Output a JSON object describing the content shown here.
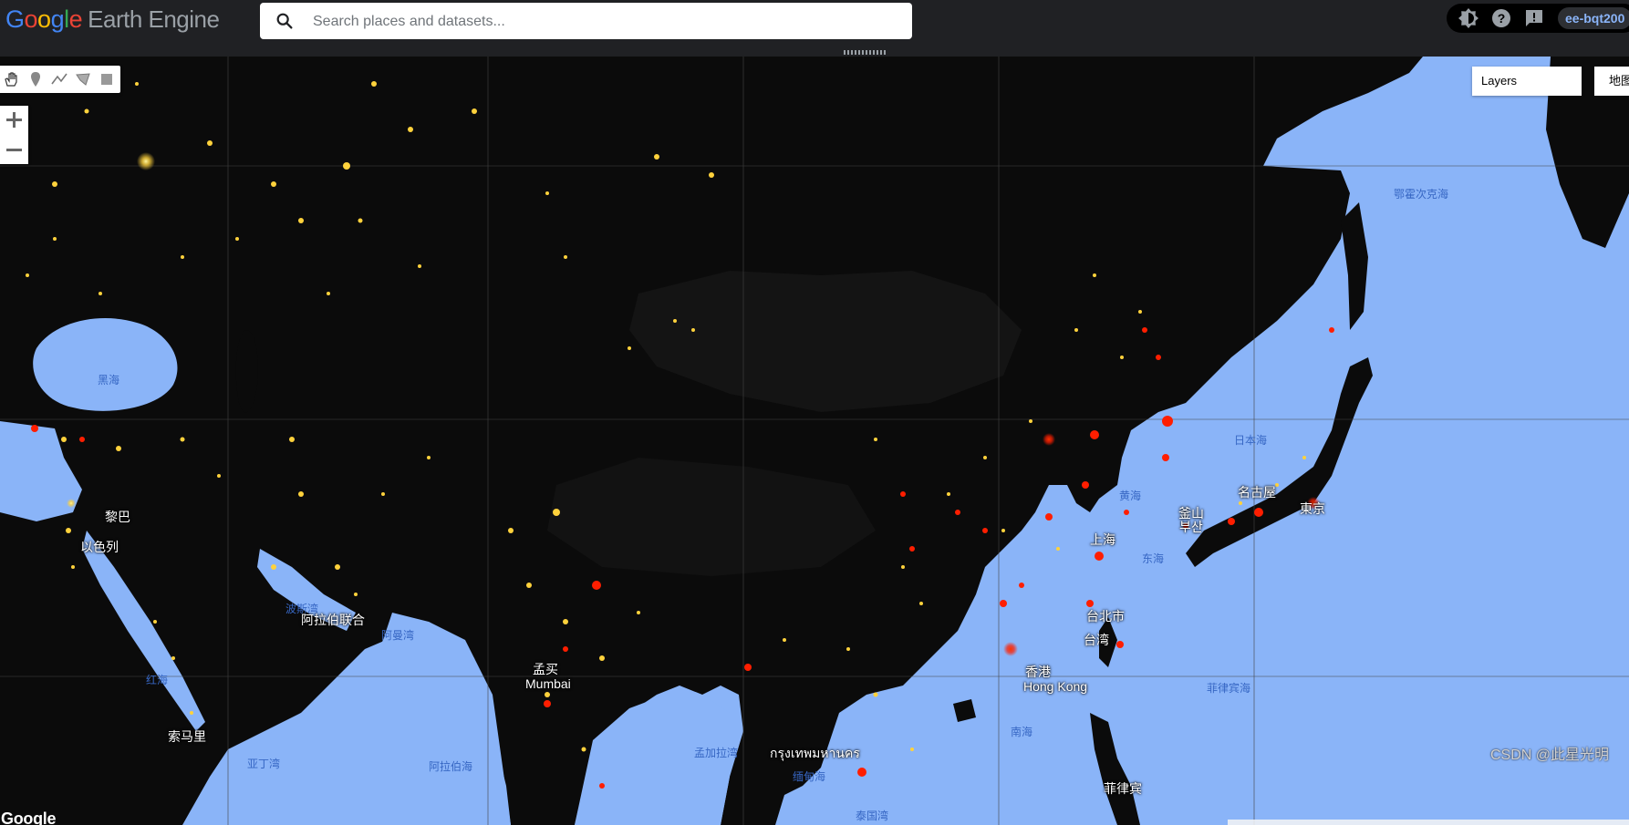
{
  "app": {
    "logo": {
      "g1": "G",
      "o1": "o",
      "o2": "o",
      "g2": "g",
      "l": "l",
      "e": "e",
      "product": "Earth Engine"
    },
    "search": {
      "placeholder": "Search places and datasets..."
    },
    "user": {
      "name": "ee-bqt200"
    },
    "icons": {
      "search": "search-icon",
      "theme": "brightness-icon",
      "help": "help-icon",
      "feedback": "feedback-icon"
    }
  },
  "map": {
    "layers_button": "Layers",
    "map_type_button": "地图",
    "google_mark": "Google",
    "watermark": "CSDN @此星光明",
    "labels": {
      "black_sea": "黑海",
      "okhotsk": "鄂霍次克海",
      "sea_of_japan": "日本海",
      "yellow_sea": "黄海",
      "east_china_sea": "东海",
      "philippine_sea": "菲律宾海",
      "south_china_sea": "南海",
      "persian_gulf": "波斯湾",
      "gulf_of_oman": "阿曼湾",
      "red_sea": "红海",
      "gulf_of_aden": "亚丁湾",
      "arabian_sea": "阿拉伯海",
      "bay_of_bengal": "孟加拉湾",
      "andaman_sea": "缅甸海",
      "gulf_of_thailand": "泰国湾",
      "beirut": "黎巴",
      "israel": "以色列",
      "uae": "阿拉伯联合",
      "somalia": "索马里",
      "taipei": "台北市",
      "taiwan": "台湾",
      "hong_kong_zh": "香港",
      "hong_kong_en": "Hong Kong",
      "busan_zh": "釜山",
      "busan_ko": "부산",
      "nagoya": "名古屋",
      "tokyo": "東京",
      "shanghai": "上海",
      "bangkok": "กรุงเทพมหานคร",
      "mumbai": "孟买",
      "mumbai_en": "Mumbai",
      "philippines": "菲律宾"
    },
    "colors": {
      "water": "#8ab4f8",
      "land": "#0a0a0a",
      "lights_yellow": "#ffd23c",
      "lights_red": "#ff1e00"
    }
  }
}
